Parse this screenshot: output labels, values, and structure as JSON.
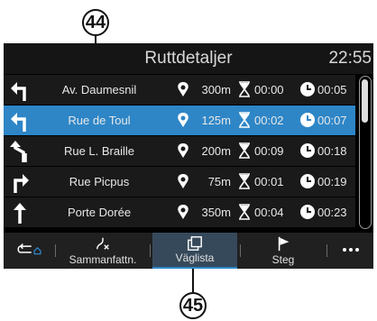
{
  "callouts": {
    "top": "44",
    "bottom": "45"
  },
  "header": {
    "title": "Ruttdetaljer",
    "time": "22:55"
  },
  "rows": [
    {
      "street": "Av. Daumesnil",
      "distance": "300m",
      "duration": "00:00",
      "eta": "00:05",
      "turn": "left-turn-icon"
    },
    {
      "street": "Rue de Toul",
      "distance": "125m",
      "duration": "00:02",
      "eta": "00:07",
      "turn": "left-turn-icon",
      "selected": true
    },
    {
      "street": "Rue L. Braille",
      "distance": "200m",
      "duration": "00:09",
      "eta": "00:18",
      "turn": "keep-left-icon"
    },
    {
      "street": "Rue Picpus",
      "distance": "75m",
      "duration": "00:01",
      "eta": "00:19",
      "turn": "right-turn-icon"
    },
    {
      "street": "Porte Dorée",
      "distance": "350m",
      "duration": "00:04",
      "eta": "00:23",
      "turn": "straight-icon"
    }
  ],
  "tabs": [
    {
      "label": "",
      "icon": "back-home-icon"
    },
    {
      "label": "Sammanfattn.",
      "icon": "route-summary-icon"
    },
    {
      "label": "Väglista",
      "icon": "route-list-icon",
      "active": true
    },
    {
      "label": "Steg",
      "icon": "flag-icon"
    },
    {
      "label": "",
      "icon": "more-icon"
    }
  ],
  "colors": {
    "selected_row": "#2e86c7",
    "screen_bg": "#000000",
    "row_bg": "#1a1a1a"
  }
}
